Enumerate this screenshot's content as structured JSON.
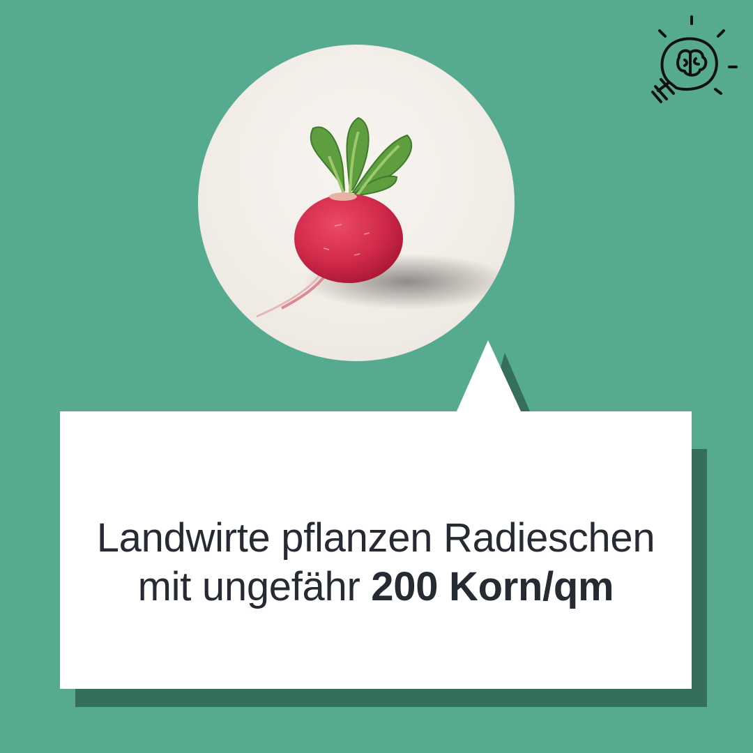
{
  "card": {
    "line1": "Landwirte pflanzen Radieschen",
    "line2_prefix": "mit ungefähr ",
    "line2_emphasis": "200 Korn/qm"
  },
  "colors": {
    "background": "#56aa8f",
    "shadow": "#366e5e",
    "bubble": "#ffffff",
    "text": "#262a33",
    "radish": "#d12a4b",
    "leaves": "#5f9e3e"
  },
  "icons": {
    "corner": "lightbulb-brain-icon",
    "photo": "radish-image"
  }
}
